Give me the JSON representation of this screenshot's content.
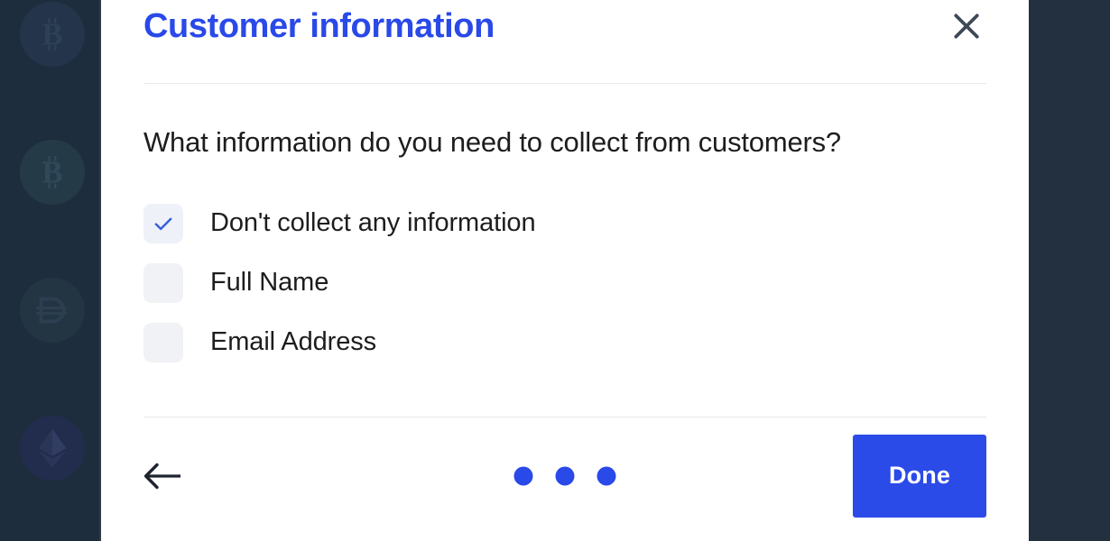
{
  "backdrop": {
    "background_color": "#1e2d3d",
    "coins": [
      {
        "name": "bitcoin-coin-icon",
        "symbol": "BTC"
      },
      {
        "name": "bitcoin-coin-icon",
        "symbol": "BTC"
      },
      {
        "name": "dai-coin-icon",
        "symbol": "DAI"
      },
      {
        "name": "ethereum-coin-icon",
        "symbol": "ETH"
      }
    ]
  },
  "modal": {
    "title": "Customer information",
    "title_color": "#2949e8",
    "close_icon": "close-icon",
    "question": "What information do you need to collect from customers?",
    "options": [
      {
        "label": "Don't collect any information",
        "checked": true
      },
      {
        "label": "Full Name",
        "checked": false
      },
      {
        "label": "Email Address",
        "checked": false
      }
    ],
    "footer": {
      "back_icon": "arrow-left-icon",
      "dots_total": 3,
      "dots_active_index": 2,
      "done_label": "Done",
      "done_color": "#2b4be8"
    }
  }
}
